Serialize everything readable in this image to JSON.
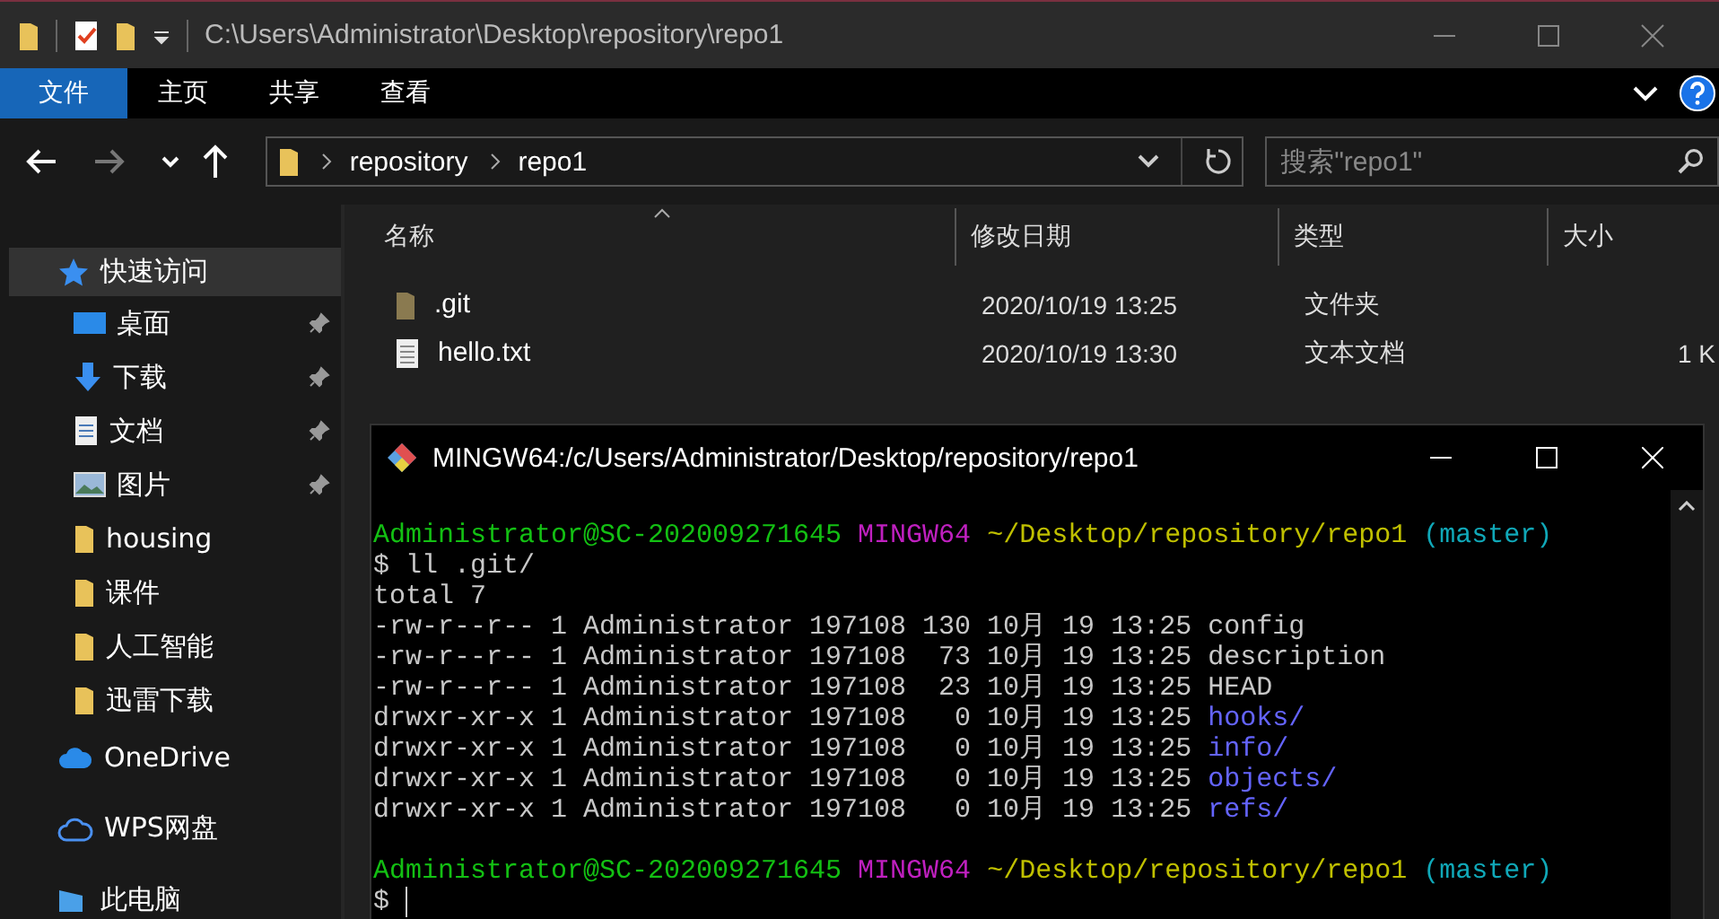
{
  "titlebar": {
    "title": "C:\\Users\\Administrator\\Desktop\\repository\\repo1"
  },
  "ribbon_tabs": [
    {
      "label": "文件",
      "selected": true
    },
    {
      "label": "主页",
      "selected": false
    },
    {
      "label": "共享",
      "selected": false
    },
    {
      "label": "查看",
      "selected": false
    }
  ],
  "nav_buttons": [
    {
      "kind": "back",
      "disabled": false
    },
    {
      "kind": "forward",
      "disabled": true
    },
    {
      "kind": "recent",
      "disabled": false
    },
    {
      "kind": "up",
      "disabled": false
    }
  ],
  "address_bar": {
    "crumbs": [
      "repository",
      "repo1"
    ]
  },
  "search": {
    "placeholder": "搜索\"repo1\""
  },
  "sidebar": {
    "items": [
      {
        "label": "快速访问",
        "kind": "quickaccess",
        "selected": true,
        "pinned": false
      },
      {
        "label": "桌面",
        "kind": "desktop",
        "selected": false,
        "pinned": true
      },
      {
        "label": "下载",
        "kind": "downloads",
        "selected": false,
        "pinned": true
      },
      {
        "label": "文档",
        "kind": "documents",
        "selected": false,
        "pinned": true
      },
      {
        "label": "图片",
        "kind": "pictures",
        "selected": false,
        "pinned": true
      },
      {
        "label": "housing",
        "kind": "folder",
        "selected": false,
        "pinned": false
      },
      {
        "label": "课件",
        "kind": "folder",
        "selected": false,
        "pinned": false
      },
      {
        "label": "人工智能",
        "kind": "folder",
        "selected": false,
        "pinned": false
      },
      {
        "label": "迅雷下载",
        "kind": "folder",
        "selected": false,
        "pinned": false
      },
      {
        "label": "OneDrive",
        "kind": "onedrive",
        "selected": false,
        "pinned": false
      },
      {
        "label": "WPS网盘",
        "kind": "wps",
        "selected": false,
        "pinned": false
      },
      {
        "label": "此电脑",
        "kind": "computer",
        "selected": false,
        "pinned": false
      }
    ]
  },
  "file_list": {
    "columns": [
      "名称",
      "修改日期",
      "类型",
      "大小"
    ],
    "rows": [
      {
        "name": ".git",
        "kind": "folder",
        "modified": "2020/10/19 13:25",
        "type": "文件夹"
      },
      {
        "name": "hello.txt",
        "kind": "text",
        "modified": "2020/10/19 13:30",
        "type": "文本文档",
        "size": "1 K"
      }
    ]
  },
  "terminal": {
    "title": "MINGW64:/c/Users/Administrator/Desktop/repository/repo1",
    "blocks": [
      {
        "lines": [
          {
            "segments": [
              {
                "text": "Administrator@SC-202009271645",
                "kind": "user"
              },
              {
                "text": "MINGW64",
                "kind": "shell"
              },
              {
                "text": "~/Desktop/repository/repo1",
                "kind": "path"
              },
              {
                "text": "(master)",
                "kind": "branch"
              }
            ]
          },
          {
            "segments": [
              {
                "text": "$ ll .git/",
                "kind": "plain"
              }
            ]
          },
          {
            "segments": [
              {
                "text": "total 7",
                "kind": "plain"
              }
            ]
          },
          {
            "segments": [
              {
                "text": "-rw-r--r-- 1 Administrator 197108 130 10月 19 13:25",
                "kind": "plain"
              },
              {
                "text": "config",
                "kind": "plain"
              }
            ]
          },
          {
            "segments": [
              {
                "text": "-rw-r--r-- 1 Administrator 197108  73 10月 19 13:25",
                "kind": "plain"
              },
              {
                "text": "description",
                "kind": "plain"
              }
            ]
          },
          {
            "segments": [
              {
                "text": "-rw-r--r-- 1 Administrator 197108  23 10月 19 13:25",
                "kind": "plain"
              },
              {
                "text": "HEAD",
                "kind": "plain"
              }
            ]
          },
          {
            "segments": [
              {
                "text": "drwxr-xr-x 1 Administrator 197108   0 10月 19 13:25",
                "kind": "plain"
              },
              {
                "text": "hooks/",
                "kind": "dir"
              }
            ]
          },
          {
            "segments": [
              {
                "text": "drwxr-xr-x 1 Administrator 197108   0 10月 19 13:25",
                "kind": "plain"
              },
              {
                "text": "info/",
                "kind": "dir"
              }
            ]
          },
          {
            "segments": [
              {
                "text": "drwxr-xr-x 1 Administrator 197108   0 10月 19 13:25",
                "kind": "plain"
              },
              {
                "text": "objects/",
                "kind": "dir"
              }
            ]
          },
          {
            "segments": [
              {
                "text": "drwxr-xr-x 1 Administrator 197108   0 10月 19 13:25",
                "kind": "plain"
              },
              {
                "text": "refs/",
                "kind": "dir"
              }
            ]
          }
        ]
      },
      {
        "lines": [
          {
            "segments": [
              {
                "text": "Administrator@SC-202009271645",
                "kind": "user"
              },
              {
                "text": "MINGW64",
                "kind": "shell"
              },
              {
                "text": "~/Desktop/repository/repo1",
                "kind": "path"
              },
              {
                "text": "(master)",
                "kind": "branch"
              }
            ]
          },
          {
            "segments": [
              {
                "text": "$",
                "kind": "plain"
              }
            ],
            "cursor": true
          }
        ]
      }
    ]
  }
}
